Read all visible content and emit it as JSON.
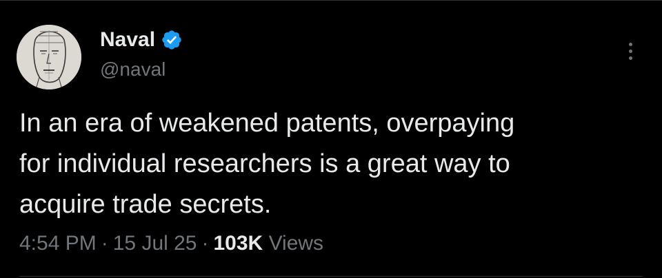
{
  "tweet": {
    "author": {
      "display_name": "Naval",
      "handle": "@naval",
      "verified": true,
      "avatar_icon": "sketch-portrait-avatar"
    },
    "text": "In an era of weakened patents, overpaying\nfor individual researchers is a great way to\nacquire trade secrets.",
    "meta": {
      "time": "4:54 PM",
      "separator": "·",
      "date": "15 Jul 25",
      "views_count": "103K",
      "views_label": "Views"
    },
    "more_icon": "more-vertical-icon"
  },
  "colors": {
    "background": "#000000",
    "primary_text": "#e7e9ea",
    "secondary_text": "#71767b",
    "verified_blue": "#1d9bf0",
    "divider": "#2f3336"
  }
}
